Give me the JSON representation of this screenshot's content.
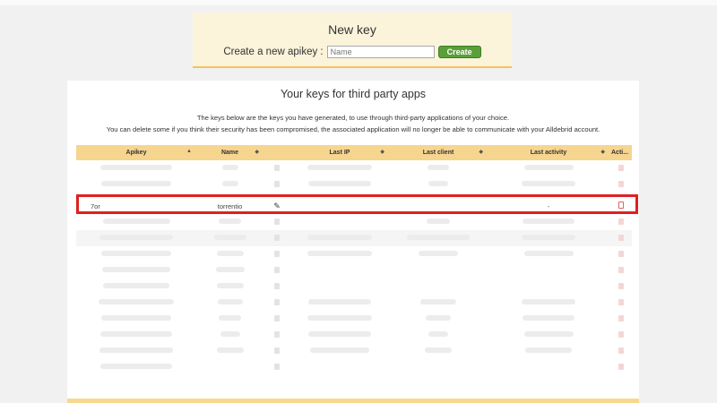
{
  "new_key": {
    "title": "New key",
    "label": "Create a new apikey :",
    "name_placeholder": "Name",
    "create_label": "Create"
  },
  "keys": {
    "title": "Your keys for third party apps",
    "desc_line1": "The keys below are the keys you have generated, to use through third-party applications of your choice.",
    "desc_line2": "You can delete some if you think their security has been compromised, the associated application will no longer be able to communicate with your Alldebrid account.",
    "columns": [
      "Apikey",
      "Name",
      "",
      "Last IP",
      "Last client",
      "Last activity",
      "Acti..."
    ],
    "highlighted_row": {
      "apikey": "7or",
      "name": "torrentio",
      "last_ip": "",
      "last_client": "",
      "last_activity": "-"
    }
  },
  "colors": {
    "accent_header": "#f6d58f",
    "create_button": "#5b9f3a",
    "highlight_border": "#e02020"
  },
  "icons": {
    "edit": "edit-icon",
    "delete": "trash-icon",
    "sort": "sort-arrows-icon"
  }
}
